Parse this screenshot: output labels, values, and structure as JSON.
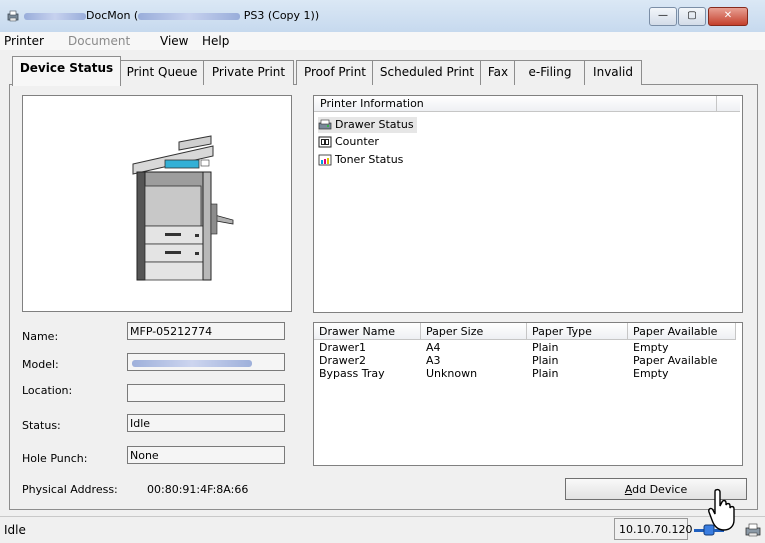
{
  "window": {
    "title_suffix": "DocMon (",
    "title_end": " PS3 (Copy 1))",
    "minimize": "—",
    "maximize": "▢",
    "close": "✕"
  },
  "menu": [
    {
      "label": "Printer",
      "enabled": true
    },
    {
      "label": "Document",
      "enabled": false
    },
    {
      "label": "View",
      "enabled": true
    },
    {
      "label": "Help",
      "enabled": true
    }
  ],
  "tabs": [
    {
      "label": "Device Status",
      "active": true
    },
    {
      "label": "Print Queue"
    },
    {
      "label": "Private Print"
    },
    {
      "label": "Proof Print"
    },
    {
      "label": "Scheduled Print"
    },
    {
      "label": "Fax"
    },
    {
      "label": "e-Filing"
    },
    {
      "label": "Invalid"
    }
  ],
  "device": {
    "name_label": "Name:",
    "name_value": "MFP-05212774",
    "model_label": "Model:",
    "location_label": "Location:",
    "location_value": "",
    "status_label": "Status:",
    "status_value": "Idle",
    "hole_punch_label": "Hole Punch:",
    "hole_punch_value": "None",
    "physical_address_label": "Physical Address:",
    "physical_address_value": "00:80:91:4F:8A:66"
  },
  "printer_info": {
    "header": "Printer Information",
    "items": [
      {
        "label": "Drawer Status",
        "icon": "drawer-status-icon"
      },
      {
        "label": "Counter",
        "icon": "counter-icon"
      },
      {
        "label": "Toner Status",
        "icon": "toner-status-icon"
      }
    ]
  },
  "drawer_table": {
    "columns": [
      "Drawer Name",
      "Paper Size",
      "Paper Type",
      "Paper Available"
    ],
    "rows": [
      [
        "Drawer1",
        "A4",
        "Plain",
        "Empty"
      ],
      [
        "Drawer2",
        "A3",
        "Plain",
        "Paper Available"
      ],
      [
        "Bypass Tray",
        "Unknown",
        "Plain",
        "Empty"
      ]
    ]
  },
  "buttons": {
    "add_device": "Add Device",
    "add_device_mnemonic": "A",
    "add_device_rest": "dd Device"
  },
  "status_bar": {
    "status": "Idle",
    "ip": "10.10.70.120"
  }
}
